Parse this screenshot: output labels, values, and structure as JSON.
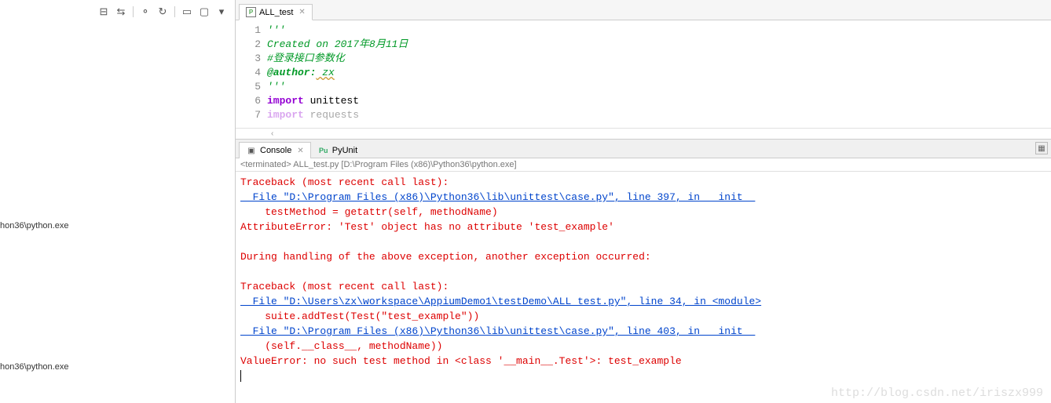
{
  "leftPane": {
    "items": [
      "hon36\\python.exe",
      "hon36\\python.exe"
    ]
  },
  "editor": {
    "tab": {
      "label": "ALL_test"
    },
    "lines": {
      "l1": "'''",
      "l2": "Created on 2017年8月11日",
      "l3": "#登录接口参数化",
      "l4a": "@author:",
      "l4b": " zx",
      "l5": "'''",
      "l6a": "import",
      "l6b": " unittest",
      "l7a": "import",
      "l7b": " requests"
    },
    "lineNumbers": [
      "1",
      "2",
      "3",
      "4",
      "5",
      "6",
      "7"
    ],
    "scrollHint": "‹"
  },
  "console": {
    "tabs": {
      "console": "Console",
      "pyunit": "PyUnit",
      "consoleBadge": "✕"
    },
    "header": "<terminated> ALL_test.py [D:\\Program Files (x86)\\Python36\\python.exe]",
    "body": {
      "r1": "Traceback (most recent call last):",
      "r2": "  File \"D:\\Program Files (x86)\\Python36\\lib\\unittest\\case.py\", line 397, in __init__",
      "r3": "    testMethod = getattr(self, methodName)",
      "r4": "AttributeError: 'Test' object has no attribute 'test_example'",
      "r5": "",
      "r6": "During handling of the above exception, another exception occurred:",
      "r7": "",
      "r8": "Traceback (most recent call last):",
      "r9": "  File \"D:\\Users\\zx\\workspace\\AppiumDemo1\\testDemo\\ALL_test.py\", line 34, in <module>",
      "r10": "    suite.addTest(Test(\"test_example\"))",
      "r11": "  File \"D:\\Program Files (x86)\\Python36\\lib\\unittest\\case.py\", line 403, in __init__",
      "r12": "    (self.__class__, methodName))",
      "r13": "ValueError: no such test method in <class '__main__.Test'>: test_example"
    }
  },
  "watermark": "http://blog.csdn.net/iriszx999",
  "icons": {
    "collapseAll": "⊟",
    "linkEditor": "⇆",
    "focusTask": "⚬",
    "syncPkg": "↻",
    "minimize": "▭",
    "maximize": "▢",
    "menu": "▾"
  }
}
